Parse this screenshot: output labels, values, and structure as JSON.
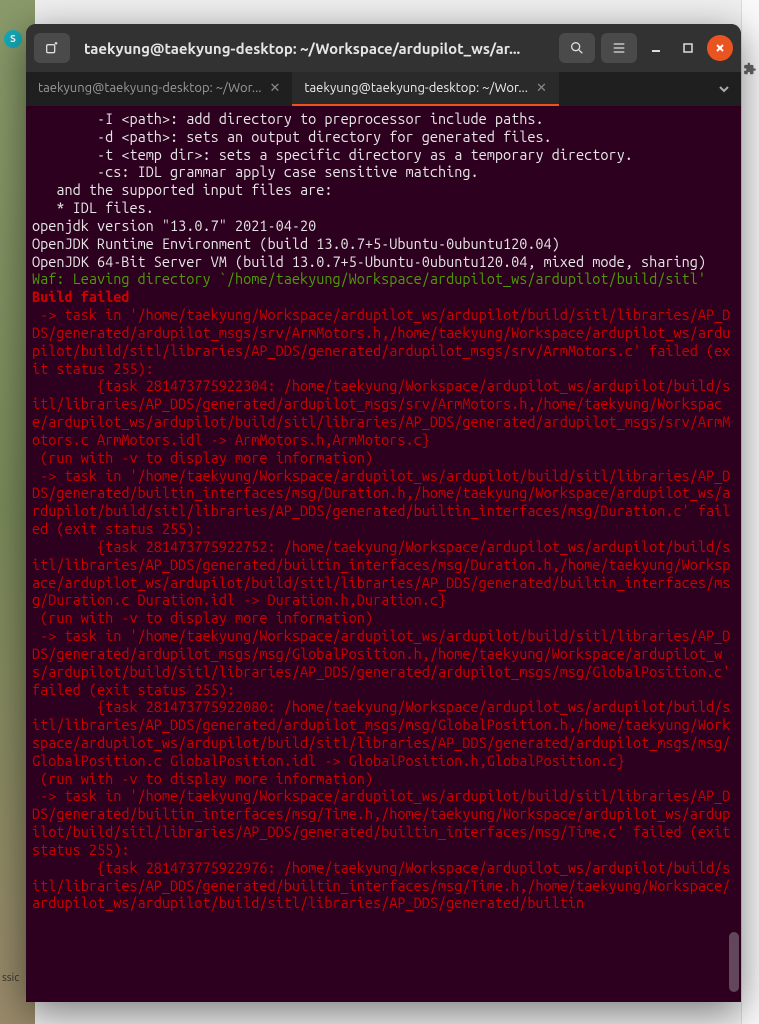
{
  "desktop": {
    "badge": "S",
    "corner_text": "ssic"
  },
  "titlebar": {
    "title": "taekyung@taekyung-desktop: ~/Workspace/ardupilot_ws/ar..."
  },
  "tabs": {
    "inactive_label": "taekyung@taekyung-desktop: ~/Wor...",
    "active_label": "taekyung@taekyung-desktop: ~/Wor..."
  },
  "terminal": {
    "l1": "        -I <path>: add directory to preprocessor include paths.",
    "l2": "        -d <path>: sets an output directory for generated files.",
    "l3": "        -t <temp dir>: sets a specific directory as a temporary directory.",
    "l4": "        -cs: IDL grammar apply case sensitive matching.",
    "l5": "   and the supported input files are:",
    "l6": "   * IDL files.",
    "blank": "",
    "l7": "openjdk version \"13.0.7\" 2021-04-20",
    "l8": "OpenJDK Runtime Environment (build 13.0.7+5-Ubuntu-0ubuntu120.04)",
    "l9": "OpenJDK 64-Bit Server VM (build 13.0.7+5-Ubuntu-0ubuntu120.04, mixed mode, sharing)",
    "waf": "Waf: Leaving directory `/home/taekyung/Workspace/ardupilot_ws/ardupilot/build/sitl'",
    "bf": "Build failed",
    "e1": " -> task in '/home/taekyung/Workspace/ardupilot_ws/ardupilot/build/sitl/libraries/AP_DDS/generated/ardupilot_msgs/srv/ArmMotors.h,/home/taekyung/Workspace/ardupilot_ws/ardupilot/build/sitl/libraries/AP_DDS/generated/ardupilot_msgs/srv/ArmMotors.c' failed (exit status 255):",
    "e1b": "        {task 281473775922304: /home/taekyung/Workspace/ardupilot_ws/ardupilot/build/sitl/libraries/AP_DDS/generated/ardupilot_msgs/srv/ArmMotors.h,/home/taekyung/Workspace/ardupilot_ws/ardupilot/build/sitl/libraries/AP_DDS/generated/ardupilot_msgs/srv/ArmMotors.c ArmMotors.idl -> ArmMotors.h,ArmMotors.c}",
    "rv": " (run with -v to display more information)",
    "e2": " -> task in '/home/taekyung/Workspace/ardupilot_ws/ardupilot/build/sitl/libraries/AP_DDS/generated/builtin_interfaces/msg/Duration.h,/home/taekyung/Workspace/ardupilot_ws/ardupilot/build/sitl/libraries/AP_DDS/generated/builtin_interfaces/msg/Duration.c' failed (exit status 255):",
    "e2b": "        {task 281473775922752: /home/taekyung/Workspace/ardupilot_ws/ardupilot/build/sitl/libraries/AP_DDS/generated/builtin_interfaces/msg/Duration.h,/home/taekyung/Workspace/ardupilot_ws/ardupilot/build/sitl/libraries/AP_DDS/generated/builtin_interfaces/msg/Duration.c Duration.idl -> Duration.h,Duration.c}",
    "e3": " -> task in '/home/taekyung/Workspace/ardupilot_ws/ardupilot/build/sitl/libraries/AP_DDS/generated/ardupilot_msgs/msg/GlobalPosition.h,/home/taekyung/Workspace/ardupilot_ws/ardupilot/build/sitl/libraries/AP_DDS/generated/ardupilot_msgs/msg/GlobalPosition.c' failed (exit status 255):",
    "e3b": "        {task 281473775922080: /home/taekyung/Workspace/ardupilot_ws/ardupilot/build/sitl/libraries/AP_DDS/generated/ardupilot_msgs/msg/GlobalPosition.h,/home/taekyung/Workspace/ardupilot_ws/ardupilot/build/sitl/libraries/AP_DDS/generated/ardupilot_msgs/msg/GlobalPosition.c GlobalPosition.idl -> GlobalPosition.h,GlobalPosition.c}",
    "e4": " -> task in '/home/taekyung/Workspace/ardupilot_ws/ardupilot/build/sitl/libraries/AP_DDS/generated/builtin_interfaces/msg/Time.h,/home/taekyung/Workspace/ardupilot_ws/ardupilot/build/sitl/libraries/AP_DDS/generated/builtin_interfaces/msg/Time.c' failed (exit status 255):",
    "e4b": "        {task 281473775922976: /home/taekyung/Workspace/ardupilot_ws/ardupilot/build/sitl/libraries/AP_DDS/generated/builtin_interfaces/msg/Time.h,/home/taekyung/Workspace/ardupilot_ws/ardupilot/build/sitl/libraries/AP_DDS/generated/builtin"
  }
}
